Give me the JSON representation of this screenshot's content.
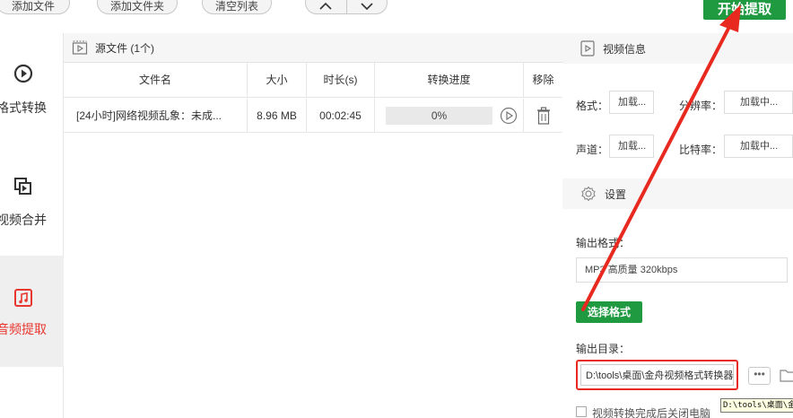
{
  "toolbar": {
    "add_file": "添加文件",
    "add_folder": "添加文件夹",
    "clear_list": "清空列表",
    "start_extract": "开始提取"
  },
  "sidebar": {
    "items": [
      {
        "label": "格式转换",
        "icon": "play-circle-icon"
      },
      {
        "label": "视频合并",
        "icon": "merge-icon"
      },
      {
        "label": "音频提取",
        "icon": "music-note-icon",
        "active": true
      }
    ]
  },
  "file_panel": {
    "title": "源文件 (1个)",
    "columns": [
      "文件名",
      "大小",
      "时长(s)",
      "转换进度",
      "移除"
    ],
    "rows": [
      {
        "name": "[24小时]网络视频乱象：未成...",
        "size": "8.96 MB",
        "duration": "00:02:45",
        "progress": "0%"
      }
    ]
  },
  "video_info": {
    "title": "视频信息",
    "format_label": "格式：",
    "format_value": "加载...",
    "resolution_label": "分辨率：",
    "resolution_value": "加载中...",
    "channel_label": "声道：",
    "channel_value": "加载...",
    "bitrate_label": "比特率：",
    "bitrate_value": "加载中..."
  },
  "settings": {
    "title": "设置",
    "output_format_label": "输出格式：",
    "output_format_value": "MP3 高质量 320kbps",
    "choose_format": "选择格式",
    "output_dir_label": "输出目录：",
    "output_dir_value": "D:\\tools\\桌面\\金舟视频格式转换器",
    "more_button": "•••",
    "tooltip": "D:\\tools\\桌面\\金舟视",
    "close_after": "视频转换完成后关闭电脑"
  },
  "colors": {
    "accent_green": "#1f9a41",
    "highlight_red": "#e8291f"
  }
}
